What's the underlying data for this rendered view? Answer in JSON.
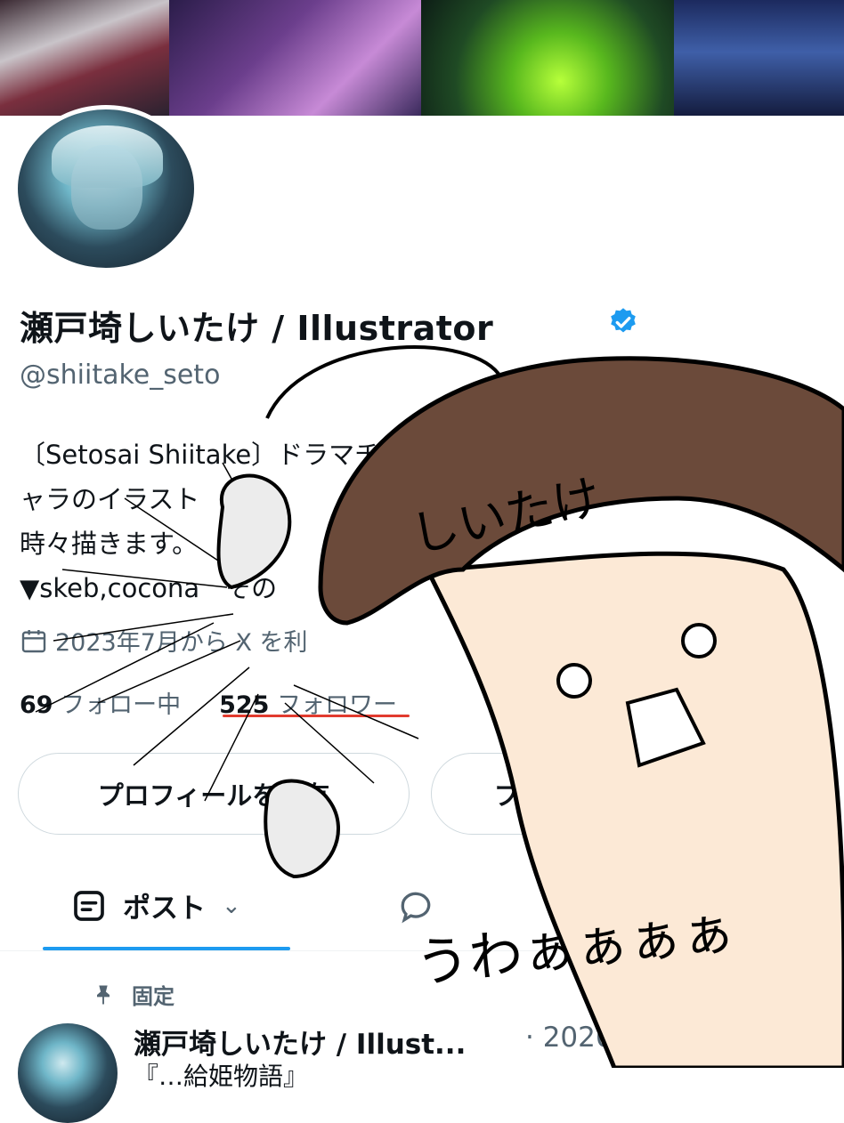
{
  "profile": {
    "name": "瀬戸埼しいたけ / Illustrator",
    "handle": "@shiitake_seto",
    "bio": [
      "〔Setosai Shiitake〕ドラマチ",
      "ャラのイラスト　心に",
      "時々描きます。",
      "▼skeb,cocona　その"
    ],
    "joined": "2023年7月から X を利",
    "following_count": "69",
    "following_label": "フォロー中",
    "followers_count": "525",
    "followers_label": "フォロワー"
  },
  "buttons": {
    "share": "プロフィールを共有",
    "second": "プロ"
  },
  "tabs": {
    "post_label": "ポスト"
  },
  "post": {
    "pinned_label": "固定",
    "author": "瀬戸埼しいたけ / Illust...",
    "date": "· 2026/07/08",
    "text": "『…給姫物語』"
  },
  "doodle": {
    "cap_text": "しいたけ",
    "exclaim": "うわぁぁぁぁ"
  },
  "colors": {
    "verified": "#1d9bf0",
    "underline": "#e23b2e",
    "cap": "#6b4a3a",
    "stem": "#fce9d6"
  },
  "icons": {
    "calendar": "calendar-icon",
    "verified": "verified-badge-icon",
    "pin": "pin-icon",
    "post": "post-tab-icon",
    "x_logo": "x-logo-icon"
  }
}
